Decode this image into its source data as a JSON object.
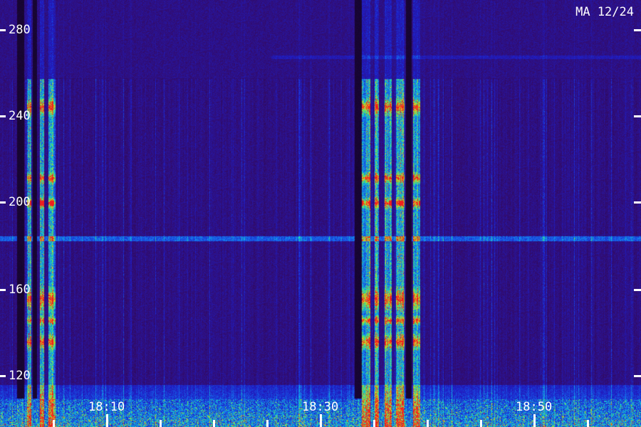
{
  "station_label": "MA 12/24",
  "y_axis": {
    "tick_labels": [
      "280",
      "240",
      "200",
      "160",
      "120"
    ]
  },
  "x_axis": {
    "tick_labels": [
      "18:10",
      "18:30",
      "18:50"
    ]
  },
  "palette": {
    "background": "#14042a",
    "low": "#3a1380",
    "mid": "#1428d8",
    "high": "#10c8c0",
    "peak": "#f02020"
  }
}
